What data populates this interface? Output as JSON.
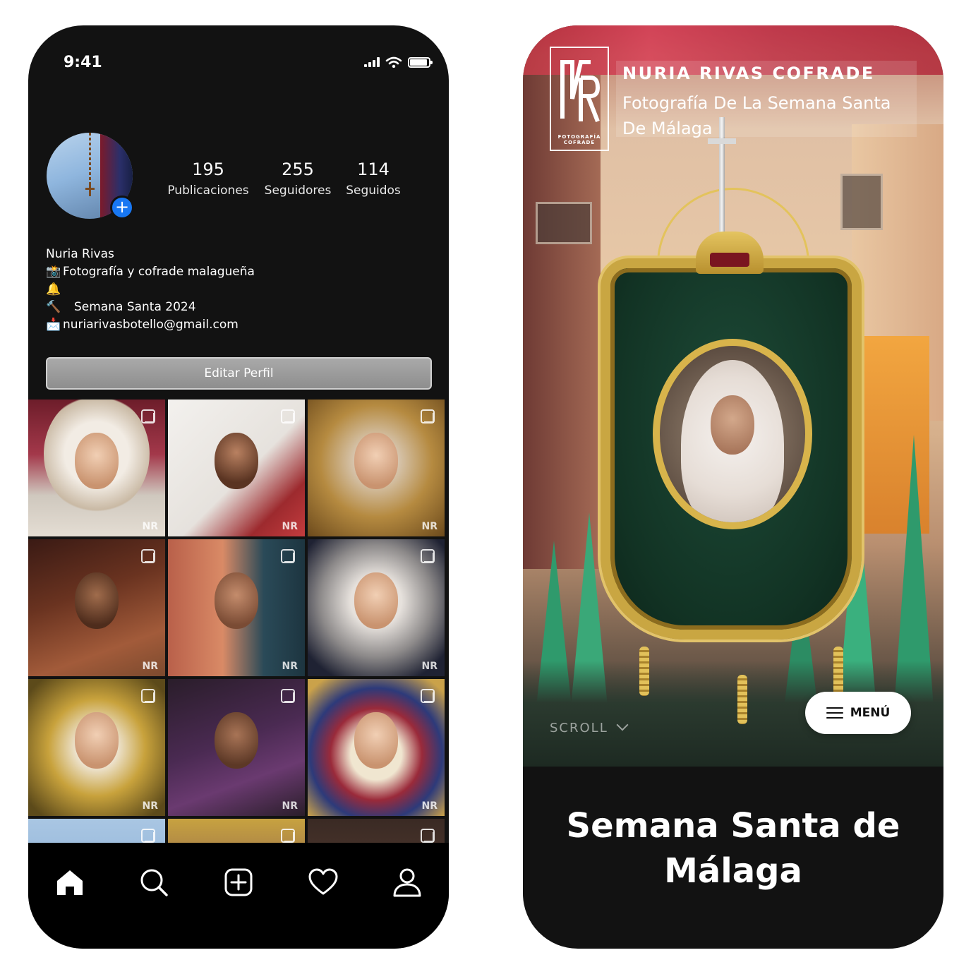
{
  "profile_screen": {
    "status_bar": {
      "time": "9:41",
      "icons": [
        "signal-icon",
        "wifi-icon",
        "battery-icon"
      ]
    },
    "stats": [
      {
        "value": "195",
        "label": "Publicaciones"
      },
      {
        "value": "255",
        "label": "Seguidores"
      },
      {
        "value": "114",
        "label": "Seguidos"
      }
    ],
    "add_badge": "+",
    "bio": {
      "name": "Nuria Rivas",
      "line1": "Fotografía y cofrade malagueña",
      "line2": "Semana Santa 2024",
      "email": "nuriarivasbotello@gmail.com",
      "line1_emoji": "📸",
      "line2_emoji": "🔔🔨",
      "email_emoji": "📩"
    },
    "edit_button": "Editar Perfil",
    "grid_watermark": "NR",
    "tabbar": [
      "home-icon",
      "search-icon",
      "add-post-icon",
      "heart-icon",
      "profile-icon"
    ]
  },
  "website_screen": {
    "brand_title": "NURIA RIVAS COFRADE",
    "brand_subtitle": "Fotografía De La Semana Santa De Málaga",
    "logo_caption_line1": "FOTOGRAFÍA",
    "logo_caption_line2": "COFRADE",
    "scroll_label": "SCROLL",
    "menu_label": "MENÚ",
    "footer_title": "Semana Santa de Málaga"
  },
  "colors": {
    "phone_bg": "#121212",
    "tabbar_bg": "#000000",
    "accent_blue": "#1877f2",
    "edit_button_bg": "#9b9b9b",
    "banner_green": "#123324",
    "banner_gold": "#c9a642",
    "nazareno_green": "#2f9a6c"
  }
}
